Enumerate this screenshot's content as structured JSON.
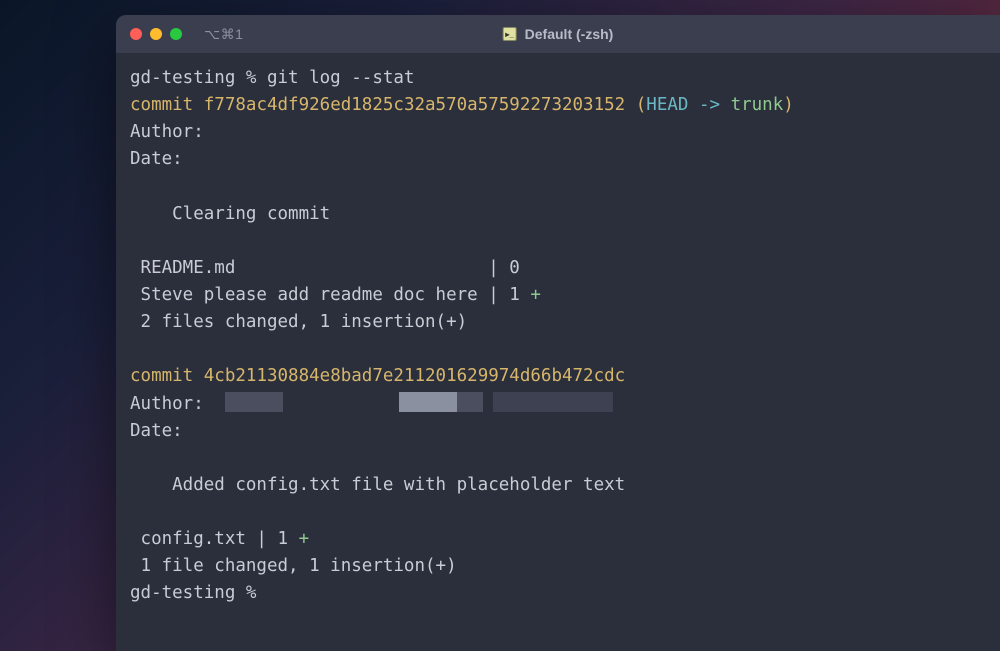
{
  "titlebar": {
    "tab_indicator": "⌥⌘1",
    "title": "Default (-zsh)"
  },
  "prompt": {
    "dir": "gd-testing",
    "sep": " % ",
    "cmd": "git log --stat"
  },
  "commits": [
    {
      "label": "commit ",
      "hash": "f778ac4df926ed1825c32a570a57592273203152",
      "ref_open": " (",
      "head": "HEAD -> ",
      "branch": "trunk",
      "ref_close": ")",
      "author_label": "Author:",
      "date_label": "Date:",
      "message": "    Clearing commit",
      "stat_lines": [
        {
          "text": " README.md                        | 0",
          "plus": ""
        },
        {
          "text": " Steve please add readme doc here | 1 ",
          "plus": "+"
        }
      ],
      "summary": " 2 files changed, 1 insertion(+)"
    },
    {
      "label": "commit ",
      "hash": "4cb21130884e8bad7e211201629974d66b472cdc",
      "author_label": "Author:  ",
      "date_label": "Date:",
      "message": "    Added config.txt file with placeholder text",
      "stat_lines": [
        {
          "text": " config.txt | 1 ",
          "plus": "+"
        }
      ],
      "summary": " 1 file changed, 1 insertion(+)"
    }
  ],
  "final_prompt": {
    "dir": "gd-testing",
    "sep": " % "
  }
}
